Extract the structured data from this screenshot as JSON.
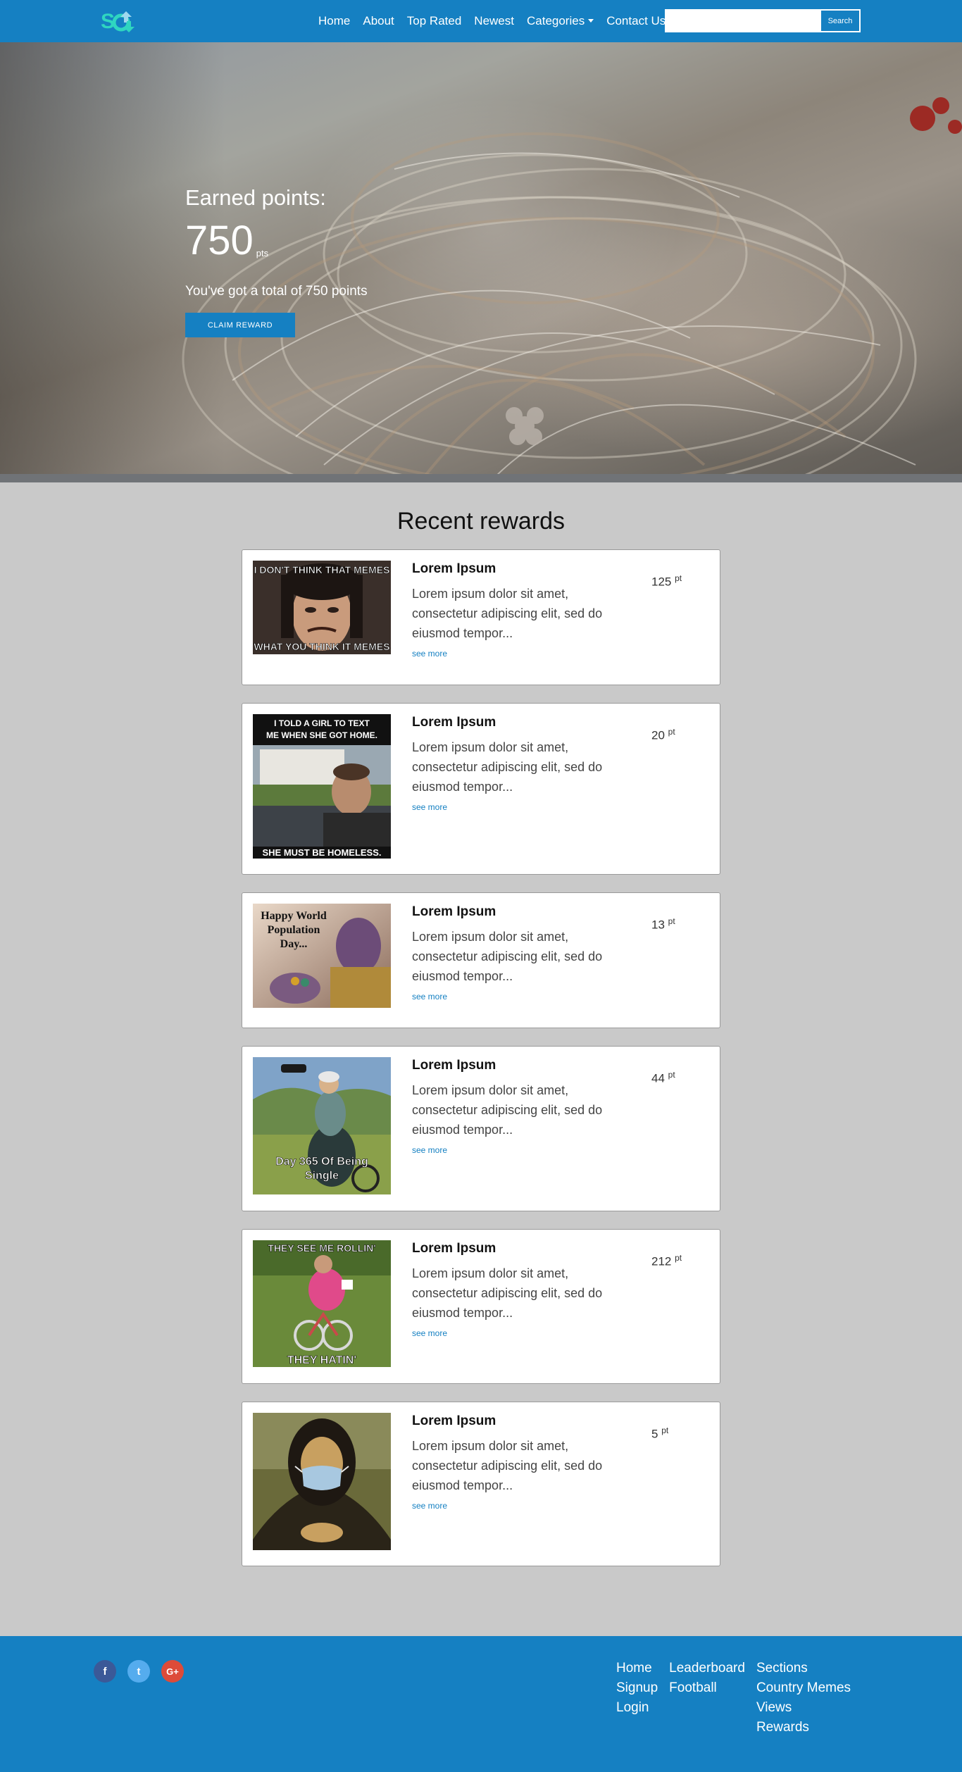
{
  "brand": {
    "logo_text": "SC"
  },
  "nav": {
    "items": [
      {
        "label": "Home"
      },
      {
        "label": "About"
      },
      {
        "label": "Top Rated"
      },
      {
        "label": "Newest"
      },
      {
        "label": "Categories"
      },
      {
        "label": "Contact Us"
      }
    ],
    "search_placeholder": "",
    "search_value": "",
    "search_button": "Search"
  },
  "hero": {
    "title": "Earned points:",
    "points": "750",
    "unit": "pts",
    "description": "You've got a total of 750 points",
    "button": "CLAIM REWARD"
  },
  "rewards": {
    "title": "Recent rewards",
    "items": [
      {
        "title": "Lorem Ipsum",
        "text": "Lorem ipsum dolor sit amet, consectetur adipiscing elit, sed do eiusmod tempor...",
        "link": "see more",
        "points": "125",
        "unit": "pt",
        "caption_top": "I DON'T THINK THAT MEMES",
        "caption_bottom": "WHAT YOU THINK IT MEMES"
      },
      {
        "title": "Lorem Ipsum",
        "text": "Lorem ipsum dolor sit amet, consectetur adipiscing elit, sed do eiusmod tempor...",
        "link": "see more",
        "points": "20",
        "unit": "pt",
        "caption_top": "I TOLD A GIRL TO TEXT ME WHEN SHE GOT HOME.",
        "caption_bottom": "SHE MUST BE HOMELESS."
      },
      {
        "title": "Lorem Ipsum",
        "text": "Lorem ipsum dolor sit amet, consectetur adipiscing elit, sed do eiusmod tempor...",
        "link": "see more",
        "points": "13",
        "unit": "pt",
        "caption_top": "Happy World Population Day...",
        "caption_bottom": ""
      },
      {
        "title": "Lorem Ipsum",
        "text": "Lorem ipsum dolor sit amet, consectetur adipiscing elit, sed do eiusmod tempor...",
        "link": "see more",
        "points": "44",
        "unit": "pt",
        "caption_top": "",
        "caption_bottom": "Day 365 Of Being Single"
      },
      {
        "title": "Lorem Ipsum",
        "text": "Lorem ipsum dolor sit amet, consectetur adipiscing elit, sed do eiusmod tempor...",
        "link": "see more",
        "points": "212",
        "unit": "pt",
        "caption_top": "THEY SEE ME ROLLIN'",
        "caption_bottom": "THEY HATIN'"
      },
      {
        "title": "Lorem Ipsum",
        "text": "Lorem ipsum dolor sit amet, consectetur adipiscing elit, sed do eiusmod tempor...",
        "link": "see more",
        "points": "5",
        "unit": "pt",
        "caption_top": "",
        "caption_bottom": ""
      }
    ]
  },
  "footer": {
    "social": [
      {
        "icon": "facebook-icon",
        "glyph": "f"
      },
      {
        "icon": "twitter-icon",
        "glyph": "t"
      },
      {
        "icon": "google-plus-icon",
        "glyph": "G+"
      }
    ],
    "columns": [
      [
        "Home",
        "Signup",
        "Login"
      ],
      [
        "Leaderboard",
        "Football"
      ],
      [
        "Sections",
        "Country Memes",
        "Views",
        "Rewards"
      ]
    ]
  },
  "colors": {
    "primary": "#1580c2",
    "background": "#c9c9c9"
  }
}
